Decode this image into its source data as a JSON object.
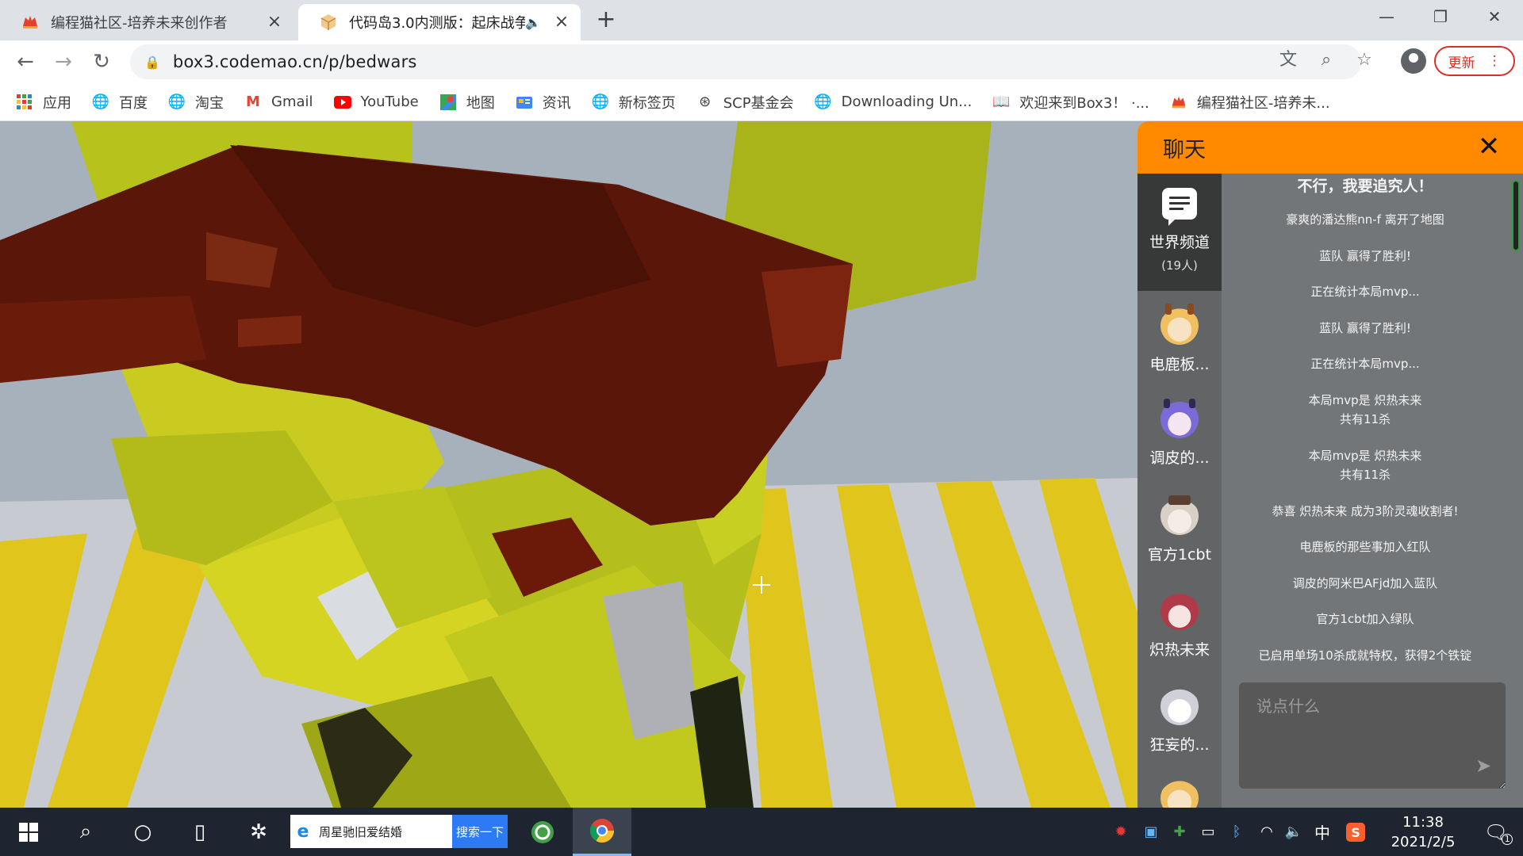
{
  "browser": {
    "tabs": [
      {
        "title": "编程猫社区-培养未来创作者",
        "active": false
      },
      {
        "title": "代码岛3.0内测版：起床战争",
        "active": true,
        "audio": true
      }
    ],
    "new_tab": "+",
    "url": "box3.codemao.cn/p/bedwars",
    "update_label": "更新",
    "bookmarks": [
      {
        "label": "应用",
        "icon": "apps-grid-icon"
      },
      {
        "label": "百度",
        "icon": "globe-icon"
      },
      {
        "label": "淘宝",
        "icon": "globe-icon"
      },
      {
        "label": "Gmail",
        "icon": "gmail-icon"
      },
      {
        "label": "YouTube",
        "icon": "youtube-icon"
      },
      {
        "label": "地图",
        "icon": "maps-icon"
      },
      {
        "label": "资讯",
        "icon": "news-icon"
      },
      {
        "label": "新标签页",
        "icon": "globe-icon"
      },
      {
        "label": "SCP基金会",
        "icon": "scp-icon"
      },
      {
        "label": "Downloading Un...",
        "icon": "globe-icon"
      },
      {
        "label": "欢迎来到Box3！ ·...",
        "icon": "book-icon"
      },
      {
        "label": "编程猫社区-培养未...",
        "icon": "codemao-icon"
      }
    ]
  },
  "chat": {
    "title": "聊天",
    "world_channel": {
      "name": "世界频道",
      "count": "(19人)"
    },
    "players": [
      {
        "name": "电鹿板...",
        "color": "#f0c060"
      },
      {
        "name": "调皮的...",
        "color": "#7c6bd6"
      },
      {
        "name": "官方1cbt",
        "color": "#d9d0c6"
      },
      {
        "name": "炽热未来",
        "color": "#b03a48"
      },
      {
        "name": "狂妄的...",
        "color": "#e8e8ee"
      }
    ],
    "messages": [
      "不行，我要追究人！",
      "豪爽的潘达熊nn-f 离开了地图",
      "蓝队 赢得了胜利!",
      "正在统计本局mvp...",
      "蓝队 赢得了胜利!",
      "正在统计本局mvp...",
      "本局mvp是 炽热未来\n共有11杀",
      "本局mvp是 炽热未来\n共有11杀",
      "恭喜 炽热未来 成为3阶灵魂收割者!",
      "电鹿板的那些事加入红队",
      "调皮的阿米巴AFjd加入蓝队",
      "官方1cbt加入绿队",
      "已启用单场10杀成就特权，获得2个铁锭"
    ],
    "input_placeholder": "说点什么"
  },
  "taskbar": {
    "search_query": "周星驰旧爱结婚",
    "search_button": "搜索一下",
    "ime": "中",
    "time": "11:38",
    "date": "2021/2/5",
    "notification_count": "1"
  },
  "colors": {
    "chat_header": "#ff8a00",
    "yellow_block": "#c8c81e",
    "brown_block": "#5a1608",
    "update_red": "#d93025"
  }
}
